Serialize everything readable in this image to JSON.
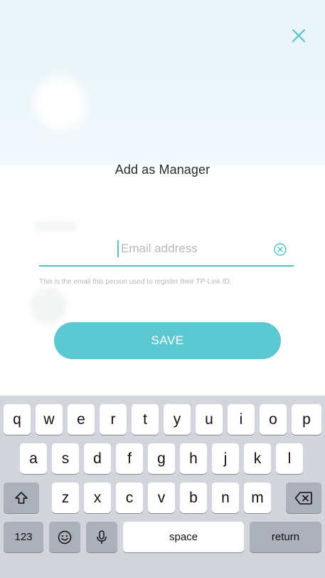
{
  "header": {
    "title": "Add as Manager"
  },
  "form": {
    "email_placeholder": "Email address",
    "email_value": "",
    "hint": "This is the email this person used to register their TP-Link ID.",
    "save_label": "SAVE"
  },
  "keyboard": {
    "row1": [
      "q",
      "w",
      "e",
      "r",
      "t",
      "y",
      "u",
      "i",
      "o",
      "p"
    ],
    "row2": [
      "a",
      "s",
      "d",
      "f",
      "g",
      "h",
      "j",
      "k",
      "l"
    ],
    "row3": [
      "z",
      "x",
      "c",
      "v",
      "b",
      "n",
      "m"
    ],
    "numbers_label": "123",
    "space_label": "space",
    "return_label": "return"
  },
  "colors": {
    "accent": "#5cc8d1",
    "keyboard_bg": "#d2d5db",
    "dark_key": "#abb0ba"
  },
  "icons": [
    "close-icon",
    "clear-icon",
    "shift-icon",
    "backspace-icon",
    "emoji-icon",
    "microphone-icon"
  ]
}
